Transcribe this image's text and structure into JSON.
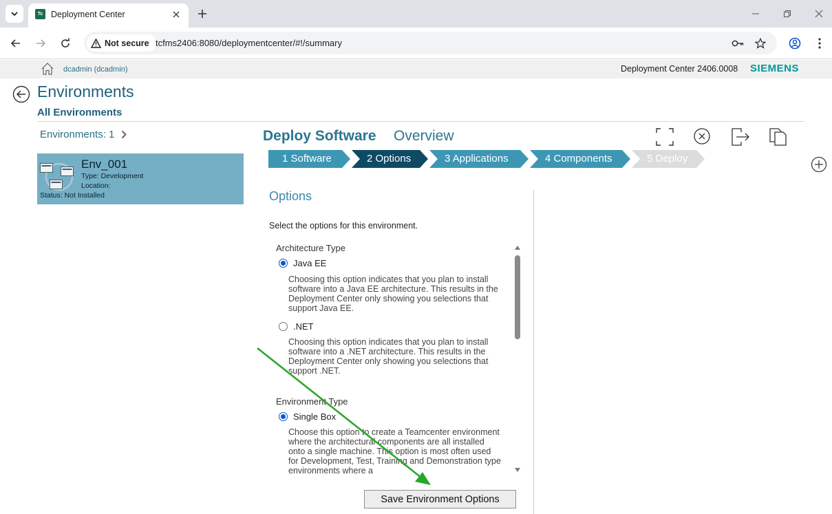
{
  "browser": {
    "tab_title": "Deployment Center",
    "favicon_text": "Tc",
    "security_label": "Not secure",
    "url": "tcfms2406:8080/deploymentcenter/#!/summary"
  },
  "header": {
    "user": "dcadmin (dcadmin)",
    "version": "Deployment Center 2406.0008",
    "brand": "SIEMENS",
    "brand_color": "#009999"
  },
  "page": {
    "title": "Environments",
    "subtitle": "All Environments",
    "env_count_label": "Environments: 1"
  },
  "environment": {
    "name": "Env_001",
    "type": "Type:  Development",
    "location": "Location:",
    "status": "Status:  Not Installed",
    "card_color": "#75afc6"
  },
  "deploy": {
    "title": "Deploy Software",
    "overview": "Overview",
    "steps": [
      {
        "label": "1 Software",
        "state": "done"
      },
      {
        "label": "2 Options",
        "state": "active"
      },
      {
        "label": "3 Applications",
        "state": "pending"
      },
      {
        "label": "4 Components",
        "state": "pending"
      },
      {
        "label": "5 Deploy",
        "state": "disabled"
      }
    ]
  },
  "options": {
    "heading": "Options",
    "description": "Select the options for this environment.",
    "architecture_label": "Architecture Type",
    "java_label": "Java EE",
    "java_desc": "Choosing this option indicates that you plan to install software into a Java EE architecture. This results in the Deployment Center only showing you selections that support Java EE.",
    "java_selected": true,
    "net_label": ".NET",
    "net_desc": "Choosing this option indicates that you plan to install software into a .NET architecture. This results in the Deployment Center only showing you selections that support .NET.",
    "net_selected": false,
    "env_type_label": "Environment Type",
    "single_box_label": "Single Box",
    "single_box_desc": "Choose this option to create a Teamcenter environment where the architectural components are all installed onto a single machine. This option is most often used for Development, Test, Training and Demonstration type environments where a",
    "single_box_selected": true,
    "save_label": "Save Environment Options"
  },
  "colors": {
    "step_active": "#0f4a64",
    "step_pending": "#3d97b4",
    "step_disabled": "#dcdcdc",
    "annotation_arrow": "#2aa52a"
  }
}
